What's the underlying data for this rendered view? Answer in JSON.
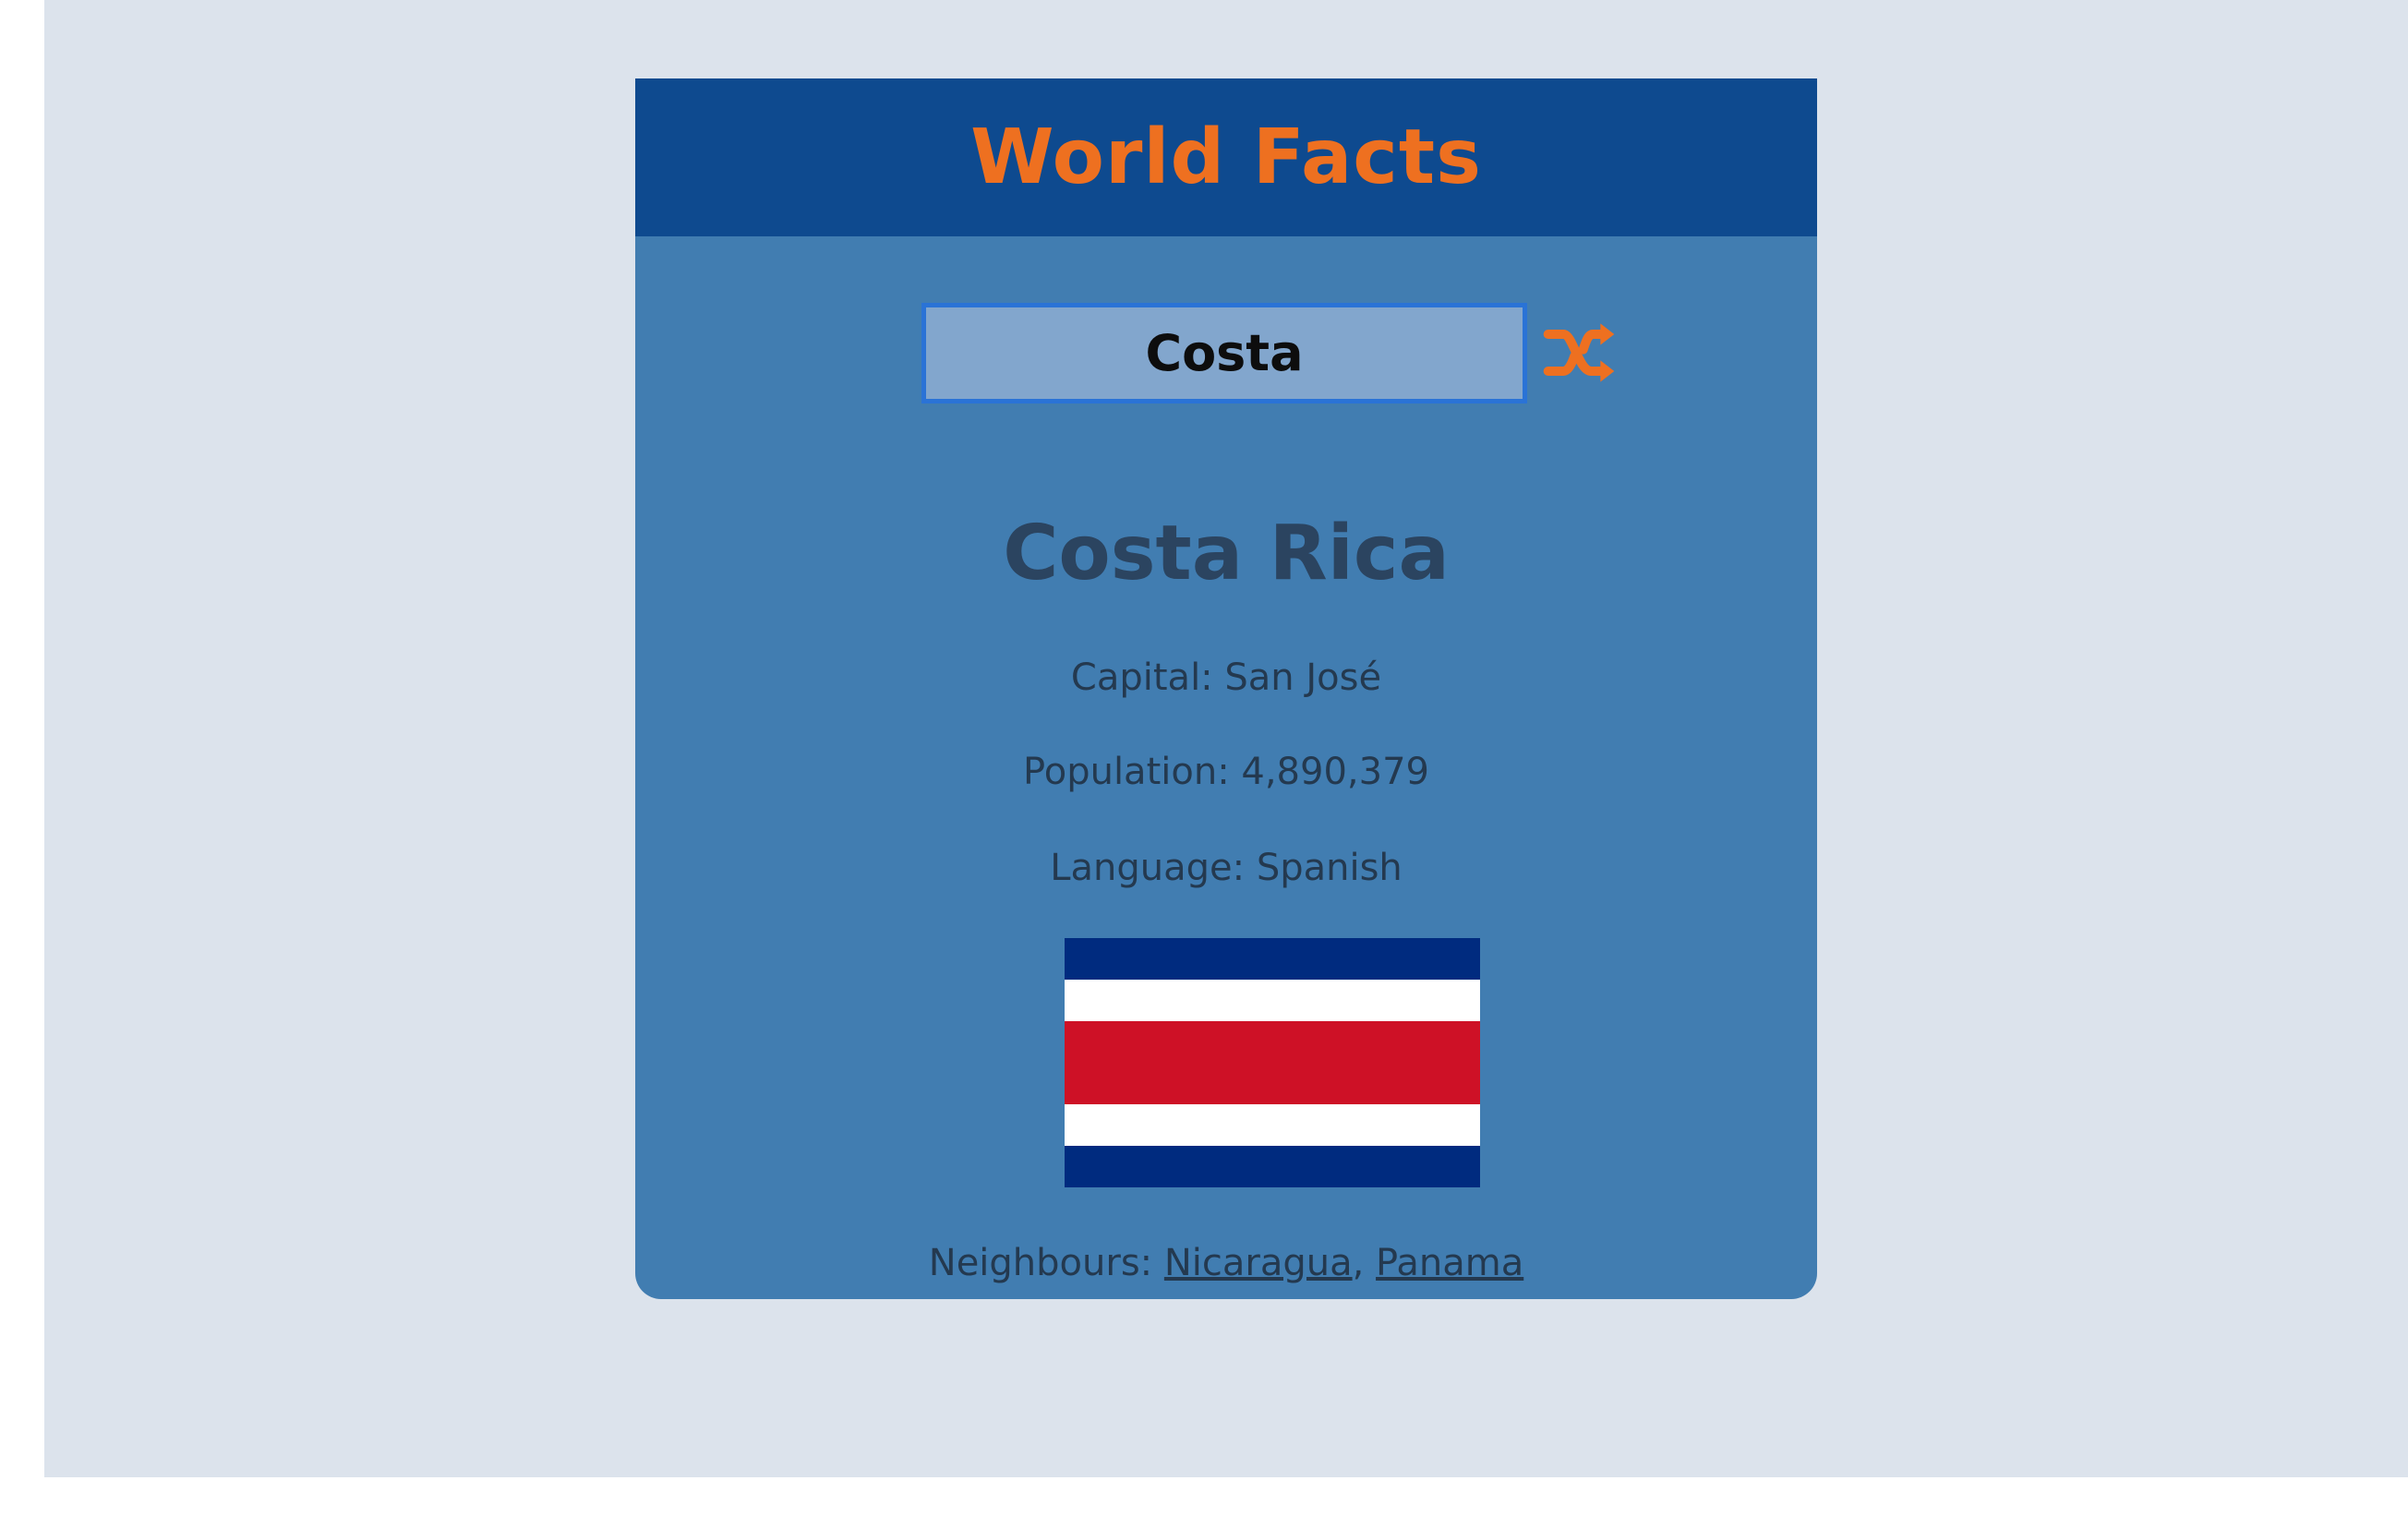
{
  "app": {
    "title": "World Facts"
  },
  "search": {
    "value": "Costa",
    "shuffle_icon": "shuffle-icon"
  },
  "country": {
    "name": "Costa Rica",
    "capital_label": "Capital:",
    "capital": "San José",
    "population_label": "Population:",
    "population": "4,890,379",
    "language_label": "Language:",
    "language": "Spanish",
    "flag": {
      "icon": "costa-rica-flag",
      "colors": [
        "#002b7f",
        "#ffffff",
        "#ce1126",
        "#ffffff",
        "#002b7f"
      ]
    },
    "neighbours_label": "Neighbours:",
    "neighbours": [
      "Nicaragua",
      "Panama"
    ],
    "neighbour_separator": ","
  },
  "colors": {
    "page_background": "#dce3ec",
    "card_background": "#417db1",
    "header_background": "#0e4a8f",
    "accent": "#ee7020",
    "input_background": "#82a6cd",
    "input_border": "#2a73d6",
    "text": "#24394f"
  }
}
